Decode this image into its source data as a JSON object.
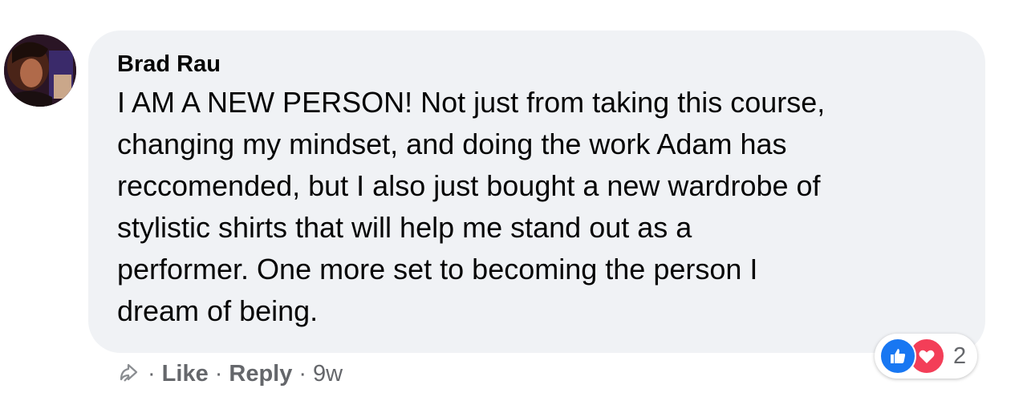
{
  "comment": {
    "author": "Brad Rau",
    "lines": [
      "I AM A NEW PERSON! Not just from taking this course,",
      "changing my mindset, and doing the work Adam has",
      "reccomended, but I also just bought a new wardrobe of",
      "stylistic shirts that will help me stand out as a",
      "performer. One more set to becoming the person I",
      "dream of being."
    ]
  },
  "actions": {
    "separator": "·",
    "like_label": "Like",
    "reply_label": "Reply",
    "time": "9w"
  },
  "reactions": {
    "types": [
      "like-icon",
      "love-icon"
    ],
    "count": "2",
    "colors": {
      "like": "#1877f2",
      "love": "#f33e58"
    }
  },
  "colors": {
    "bubble": "#f0f2f5",
    "text": "#050505",
    "meta": "#65676b"
  }
}
